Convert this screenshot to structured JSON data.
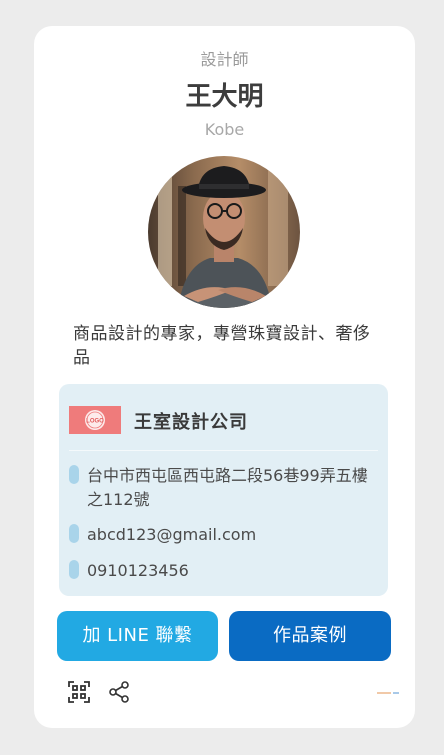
{
  "profile": {
    "job_title": "設計師",
    "name": "王大明",
    "nickname": "Kobe",
    "intro": "商品設計的專家，專營珠寶設計、奢侈品"
  },
  "company": {
    "name": "王室設計公司",
    "logo_text": "LOGO",
    "address": "台中市西屯區西屯路二段56巷99弄五樓之112號",
    "email": "abcd123@gmail.com",
    "phone": "0910123456"
  },
  "actions": {
    "line_label": "加 LINE 聯繫",
    "works_label": "作品案例"
  },
  "footer": {
    "qr_icon": "qr-code-icon",
    "share_icon": "share-icon"
  },
  "colors": {
    "line_button": "#22a9e3",
    "works_button": "#0a6bc3",
    "company_box": "#e2eff5",
    "info_marker": "#a9d4ea",
    "logo_red": "#ef7b7b"
  }
}
